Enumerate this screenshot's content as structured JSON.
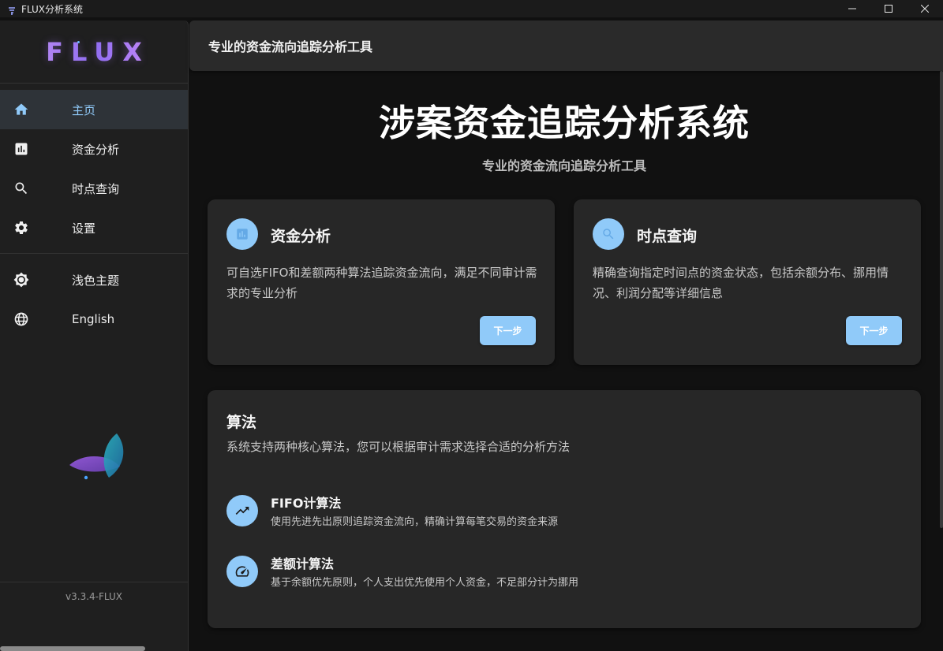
{
  "window": {
    "title": "FLUX分析系统",
    "controls": [
      "minimize-icon",
      "maximize-icon",
      "close-icon"
    ]
  },
  "sidebar": {
    "logo": "FLUX",
    "items": [
      {
        "label": "主页",
        "icon": "home-icon",
        "active": true
      },
      {
        "label": "资金分析",
        "icon": "bar-chart-icon",
        "active": false
      },
      {
        "label": "时点查询",
        "icon": "search-icon",
        "active": false
      },
      {
        "label": "设置",
        "icon": "gear-icon",
        "active": false
      }
    ],
    "extra_items": [
      {
        "label": "浅色主题",
        "icon": "brightness-icon"
      },
      {
        "label": "English",
        "icon": "globe-icon"
      }
    ],
    "version": "v3.3.4-FLUX"
  },
  "topbar": {
    "title": "专业的资金流向追踪分析工具"
  },
  "hero": {
    "title": "涉案资金追踪分析系统",
    "subtitle": "专业的资金流向追踪分析工具"
  },
  "features": [
    {
      "title": "资金分析",
      "icon": "bar-chart-icon",
      "description": "可自选FIFO和差额两种算法追踪资金流向，满足不同审计需求的专业分析",
      "button": "下一步"
    },
    {
      "title": "时点查询",
      "icon": "search-icon",
      "description": "精确查询指定时间点的资金状态，包括余额分布、挪用情况、利润分配等详细信息",
      "button": "下一步"
    }
  ],
  "algorithms": {
    "title": "算法",
    "description": "系统支持两种核心算法，您可以根据审计需求选择合适的分析方法",
    "items": [
      {
        "title": "FIFO计算法",
        "icon": "trending-up-icon",
        "description": "使用先进先出原则追踪资金流向，精确计算每笔交易的资金来源"
      },
      {
        "title": "差额计算法",
        "icon": "speedometer-icon",
        "description": "基于余额优先原则，个人支出优先使用个人资金，不足部分计为挪用"
      }
    ]
  },
  "colors": {
    "accent": "#90caf9",
    "background": "#111111",
    "card": "#272727",
    "sidebar": "#1f1f1f"
  }
}
